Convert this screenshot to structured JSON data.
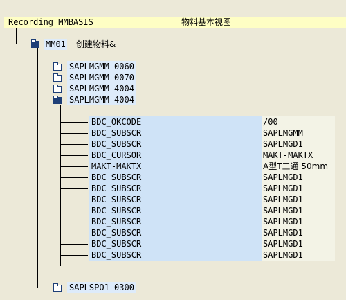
{
  "header": {
    "recording_label": "Recording MMBASIS",
    "description": "物料基本视图"
  },
  "root": {
    "transaction": "MM01",
    "description": "创建物料&"
  },
  "screens": [
    {
      "program": "SAPLMGMM",
      "dynpro": "0060",
      "expanded": false
    },
    {
      "program": "SAPLMGMM",
      "dynpro": "0070",
      "expanded": false
    },
    {
      "program": "SAPLMGMM",
      "dynpro": "4004",
      "expanded": false
    },
    {
      "program": "SAPLMGMM",
      "dynpro": "4004",
      "expanded": true
    }
  ],
  "fields": [
    {
      "name": "BDC_OKCODE",
      "value": "/00"
    },
    {
      "name": "BDC_SUBSCR",
      "value": "SAPLMGMM"
    },
    {
      "name": "BDC_SUBSCR",
      "value": "SAPLMGD1"
    },
    {
      "name": "BDC_CURSOR",
      "value": "MAKT-MAKTX"
    },
    {
      "name": "MAKT-MAKTX",
      "value": "A型T三通 50mm"
    },
    {
      "name": "BDC_SUBSCR",
      "value": "SAPLMGD1"
    },
    {
      "name": "BDC_SUBSCR",
      "value": "SAPLMGD1"
    },
    {
      "name": "BDC_SUBSCR",
      "value": "SAPLMGD1"
    },
    {
      "name": "BDC_SUBSCR",
      "value": "SAPLMGD1"
    },
    {
      "name": "BDC_SUBSCR",
      "value": "SAPLMGD1"
    },
    {
      "name": "BDC_SUBSCR",
      "value": "SAPLMGD1"
    },
    {
      "name": "BDC_SUBSCR",
      "value": "SAPLMGD1"
    },
    {
      "name": "BDC_SUBSCR",
      "value": "SAPLMGD1"
    }
  ],
  "last_screen": {
    "program": "SAPLSPO1",
    "dynpro": "0300",
    "expanded": false
  }
}
